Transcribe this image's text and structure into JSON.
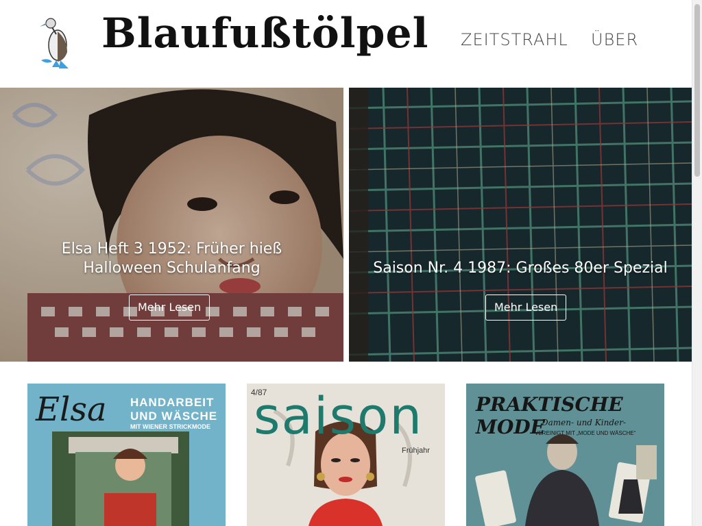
{
  "brand": {
    "name": "Blaufußtölpel",
    "logo_icon": "blue-footed-booby-icon"
  },
  "nav": [
    {
      "label": "ZEITSTRAHL"
    },
    {
      "label": "ÜBER"
    }
  ],
  "hero": [
    {
      "title": "Elsa Heft 3 1952: Früher hieß Halloween Schulanfang",
      "button": "Mehr Lesen"
    },
    {
      "title": "Saison Nr. 4 1987: Großes 80er Spezial",
      "button": "Mehr Lesen"
    }
  ],
  "covers": [
    {
      "masthead": "Elsa",
      "line1": "HANDARBEIT",
      "line2": "UND WÄSCHE",
      "line3": "MIT WIENER STRICKMODE"
    },
    {
      "masthead": "saison",
      "issue": "4/87",
      "season": "Frühjahr"
    },
    {
      "masthead": "PRAKTISCHE MODE",
      "line1": "Damen- und Kinder-",
      "line2": "VEREINIGT MIT „MODE UND WÄSCHE“"
    }
  ],
  "colors": {
    "accent": "#5aa3d8",
    "text": "#111111"
  }
}
